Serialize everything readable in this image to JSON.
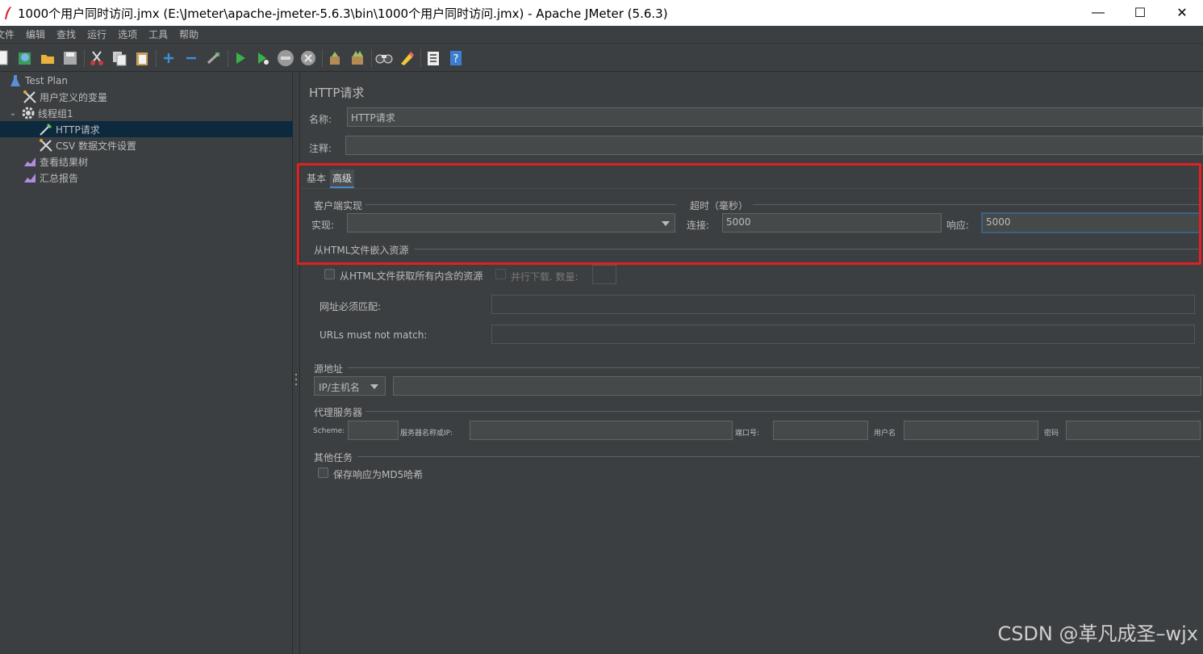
{
  "window": {
    "title": "1000个用户同时访问.jmx (E:\\Jmeter\\apache-jmeter-5.6.3\\bin\\1000个用户同时访问.jmx) - Apache JMeter (5.6.3)",
    "minimize": "—",
    "maximize": "☐",
    "close": "✕"
  },
  "menu": [
    "文件",
    "编辑",
    "查找",
    "运行",
    "选项",
    "工具",
    "帮助"
  ],
  "toolbar": [
    "new-icon",
    "templates-icon",
    "open-icon",
    "save-icon",
    "cut-icon",
    "copy-icon",
    "paste-icon",
    "expand-icon",
    "collapse-icon",
    "toggle-icon",
    "start-icon",
    "start-no-pause-icon",
    "stop-icon",
    "shutdown-icon",
    "clear-icon",
    "clear-all-icon",
    "search-icon",
    "reset-search-icon",
    "function-helper-icon",
    "help-icon"
  ],
  "tree": {
    "items": [
      {
        "label": "Test Plan",
        "icon": "test-plan-icon"
      },
      {
        "label": "用户定义的变量",
        "icon": "config-icon"
      },
      {
        "label": "线程组1",
        "icon": "gear-icon"
      },
      {
        "label": "HTTP请求",
        "icon": "sampler-icon"
      },
      {
        "label": "CSV 数据文件设置",
        "icon": "config-icon"
      },
      {
        "label": "查看结果树",
        "icon": "listener-icon"
      },
      {
        "label": "汇总报告",
        "icon": "listener-icon"
      }
    ]
  },
  "panel": {
    "title": "HTTP请求",
    "name_label": "名称:",
    "name_value": "HTTP请求",
    "comment_label": "注释:",
    "comment_value": "",
    "tabs": [
      "基本",
      "高级"
    ],
    "client_impl": {
      "group": "客户端实现",
      "impl_label": "实现:",
      "impl_value": ""
    },
    "timeout": {
      "group": "超时（毫秒）",
      "connect_label": "连接:",
      "connect_value": "5000",
      "response_label": "响应:",
      "response_value": "5000"
    },
    "embedded": {
      "group": "从HTML文件嵌入资源",
      "retrieve_label": "从HTML文件获取所有内含的资源",
      "parallel_label": "并行下载. 数量:",
      "match_label": "网址必须匹配:",
      "notmatch_label": "URLs must not match:"
    },
    "source": {
      "group": "源地址",
      "type_value": "IP/主机名"
    },
    "proxy": {
      "group": "代理服务器",
      "scheme_label": "Scheme:",
      "server_label": "服务器名称或IP:",
      "port_label": "端口号:",
      "user_label": "用户名",
      "password_label": "密码"
    },
    "other": {
      "group": "其他任务",
      "md5_label": "保存响应为MD5哈希"
    }
  },
  "watermark": "CSDN @革凡成圣–wjx",
  "colors": {
    "background": "#3c3f41",
    "selection": "#0d293e",
    "highlight": "#e2201f",
    "field": "#45494a"
  }
}
